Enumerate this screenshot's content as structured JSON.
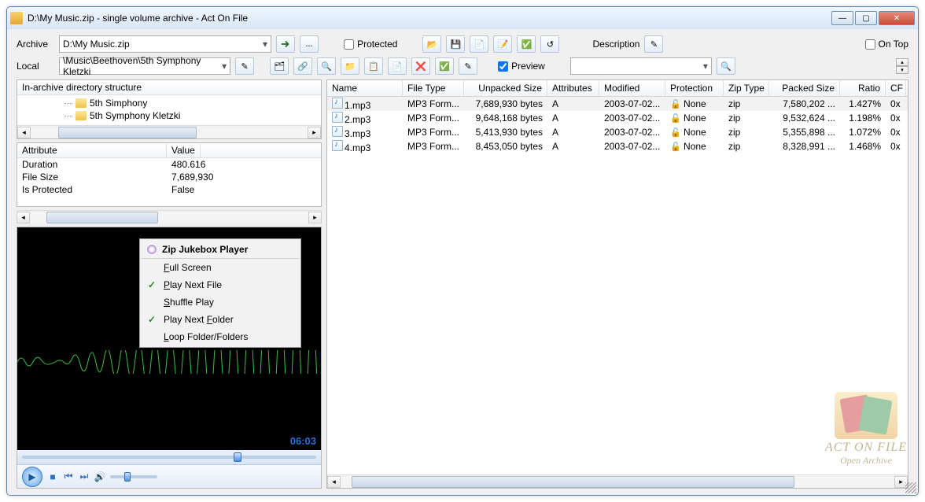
{
  "window": {
    "title": "D:\\My Music.zip - single volume archive - Act On File"
  },
  "toolbar": {
    "archive_label": "Archive",
    "archive_path": "D:\\My Music.zip",
    "local_label": "Local",
    "local_path": "\\Music\\Beethoven\\5th Symphony Kletzki",
    "protected_label": "Protected",
    "preview_label": "Preview",
    "description_label": "Description",
    "ontop_label": "On Top",
    "browse_label": "..."
  },
  "tree": {
    "header": "In-archive directory structure",
    "items": [
      "5th Simphony",
      "5th Symphony Kletzki"
    ]
  },
  "attributes": {
    "col1": "Attribute",
    "col2": "Value",
    "rows": [
      {
        "k": "Duration",
        "v": "480.616"
      },
      {
        "k": "File Size",
        "v": "7,689,930"
      },
      {
        "k": "Is Protected",
        "v": "False"
      }
    ]
  },
  "player": {
    "time": "06:03",
    "menu_title": "Zip Jukebox Player",
    "menu_items": [
      {
        "label": "Full Screen",
        "ul": 0,
        "checked": false
      },
      {
        "label": "Play Next File",
        "ul": 0,
        "checked": true
      },
      {
        "label": "Shuffle Play",
        "ul": 0,
        "checked": false
      },
      {
        "label": "Play Next Folder",
        "ul": 10,
        "checked": true
      },
      {
        "label": "Loop Folder/Folders",
        "ul": 0,
        "checked": false
      }
    ]
  },
  "grid": {
    "cols": [
      "Name",
      "File Type",
      "Unpacked Size",
      "Attributes",
      "Modified",
      "Protection",
      "Zip Type",
      "Packed Size",
      "Ratio",
      "CF"
    ],
    "rows": [
      {
        "name": "1.mp3",
        "ft": "MP3 Form...",
        "us": "7,689,930 bytes",
        "at": "A",
        "mod": "2003-07-02...",
        "prot": "None",
        "zt": "zip",
        "ps": "7,580,202 ...",
        "ratio": "1.427%",
        "cf": "0x"
      },
      {
        "name": "2.mp3",
        "ft": "MP3 Form...",
        "us": "9,648,168 bytes",
        "at": "A",
        "mod": "2003-07-02...",
        "prot": "None",
        "zt": "zip",
        "ps": "9,532,624 ...",
        "ratio": "1.198%",
        "cf": "0x"
      },
      {
        "name": "3.mp3",
        "ft": "MP3 Form...",
        "us": "5,413,930 bytes",
        "at": "A",
        "mod": "2003-07-02...",
        "prot": "None",
        "zt": "zip",
        "ps": "5,355,898 ...",
        "ratio": "1.072%",
        "cf": "0x"
      },
      {
        "name": "4.mp3",
        "ft": "MP3 Form...",
        "us": "8,453,050 bytes",
        "at": "A",
        "mod": "2003-07-02...",
        "prot": "None",
        "zt": "zip",
        "ps": "8,328,991 ...",
        "ratio": "1.468%",
        "cf": "0x"
      }
    ]
  },
  "watermark": {
    "l1": "ACT ON FILE",
    "l2": "Open Archive"
  }
}
